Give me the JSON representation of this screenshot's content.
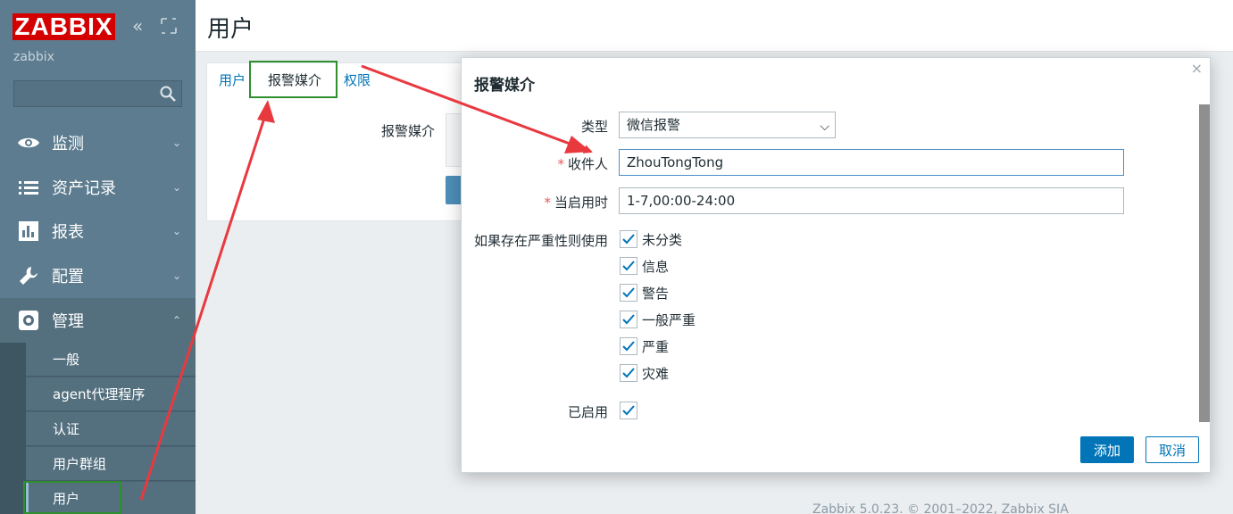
{
  "brand": {
    "logo_text": "ZABBIX",
    "server_name": "zabbix"
  },
  "sidebar": {
    "search_placeholder": "",
    "menu": [
      {
        "label": "监测",
        "icon": "eye-icon"
      },
      {
        "label": "资产记录",
        "icon": "list-icon"
      },
      {
        "label": "报表",
        "icon": "bar-chart-icon"
      },
      {
        "label": "配置",
        "icon": "wrench-icon"
      },
      {
        "label": "管理",
        "icon": "gear-icon"
      }
    ],
    "submenu": [
      {
        "label": "一般"
      },
      {
        "label": "agent代理程序"
      },
      {
        "label": "认证"
      },
      {
        "label": "用户群组"
      },
      {
        "label": "用户"
      }
    ]
  },
  "page": {
    "title": "用户",
    "tabs": [
      "用户",
      "报警媒介",
      "权限"
    ],
    "media_label": "报警媒介",
    "footer": "Zabbix 5.0.23. © 2001–2022, Zabbix SIA"
  },
  "modal": {
    "title": "报警媒介",
    "close": "×",
    "type_label": "类型",
    "type_value": "微信报警",
    "sendto_label": "收件人",
    "sendto_value": "ZhouTongTong",
    "period_label": "当启用时",
    "period_value": "1-7,00:00-24:00",
    "severity_label": "如果存在严重性则使用",
    "severities": [
      {
        "label": "未分类",
        "checked": true
      },
      {
        "label": "信息",
        "checked": true
      },
      {
        "label": "警告",
        "checked": true
      },
      {
        "label": "一般严重",
        "checked": true
      },
      {
        "label": "严重",
        "checked": true
      },
      {
        "label": "灾难",
        "checked": true
      }
    ],
    "enabled_label": "已启用",
    "enabled": true,
    "add_button": "添加",
    "cancel_button": "取消",
    "required_marker": "*"
  },
  "colors": {
    "accent": "#0275b8",
    "sidebar": "#5d7c8f",
    "annotation_arrow": "#e8393f",
    "annotation_box": "#2f8f2f"
  }
}
